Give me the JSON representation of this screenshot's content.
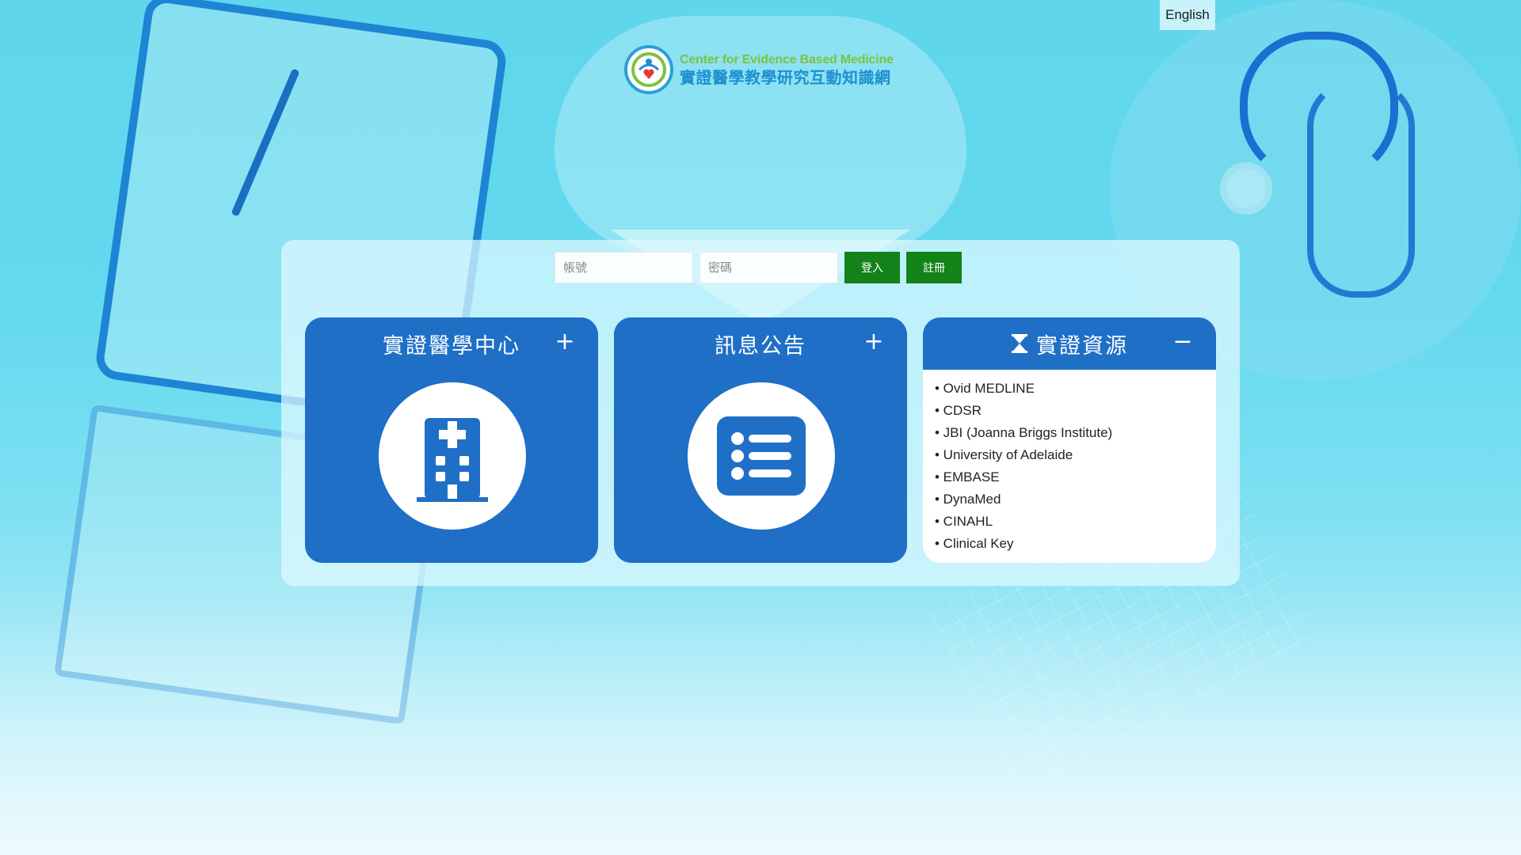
{
  "language": {
    "switch_label": "English"
  },
  "logo": {
    "title_en": "Center for Evidence Based Medicine",
    "title_zh": "實證醫學教學研究互動知識網"
  },
  "login": {
    "account_placeholder": "帳號",
    "password_placeholder": "密碼",
    "login_label": "登入",
    "register_label": "註冊"
  },
  "cards": [
    {
      "title": "實證醫學中心",
      "toggle": "+",
      "icon": "hospital-icon"
    },
    {
      "title": "訊息公告",
      "toggle": "+",
      "icon": "list-icon"
    },
    {
      "title": "實證資源",
      "toggle": "−",
      "icon": "hourglass-icon",
      "items": [
        "• Ovid MEDLINE",
        "• CDSR",
        "• JBI (Joanna Briggs Institute)",
        "• University of Adelaide",
        "• EMBASE",
        "• DynaMed",
        "• CINAHL",
        "• Clinical Key"
      ]
    }
  ],
  "colors": {
    "card_blue": "#1f6fc7",
    "button_green": "#138219",
    "logo_green": "#7cc241",
    "logo_blue": "#1f8fd0",
    "background_cyan": "#63d9ef"
  }
}
